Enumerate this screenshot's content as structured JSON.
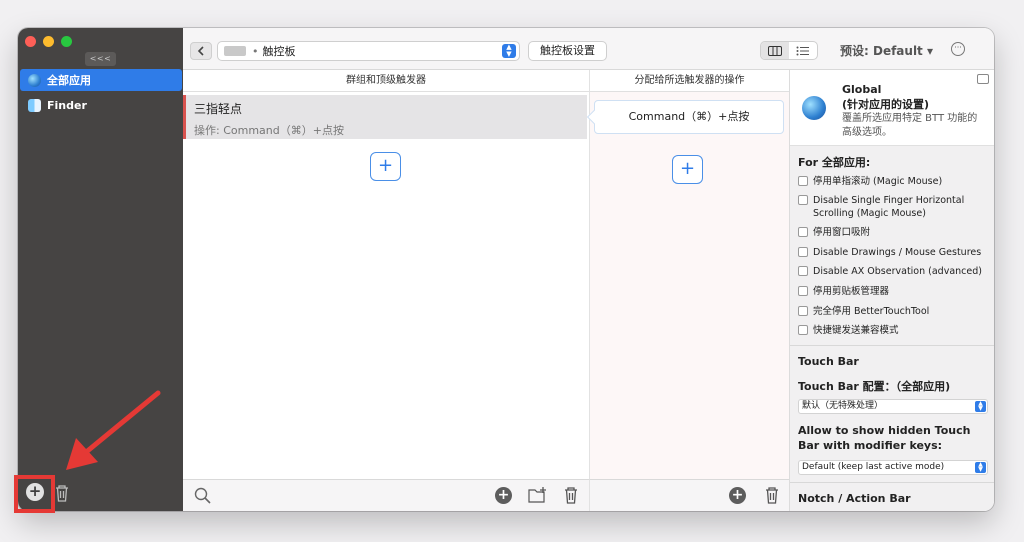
{
  "sidebar": {
    "collapse_label": "<<<",
    "apps": [
      {
        "label": "全部应用",
        "icon": "globe-icon",
        "selected": true
      },
      {
        "label": "Finder",
        "icon": "finder-icon",
        "selected": false
      }
    ]
  },
  "toolbar": {
    "device": "触控板",
    "settings_label": "触控板设置",
    "preset": "预设: Default ▾"
  },
  "triggers": {
    "header": "群组和顶级触发器",
    "items": [
      {
        "title": "三指轻点",
        "subtitle": "操作: Command（⌘）+点按"
      }
    ]
  },
  "actions": {
    "header": "分配给所选触发器的操作",
    "items": [
      {
        "label": "Command（⌘）+点按"
      }
    ]
  },
  "right_panel": {
    "title_line1": "Global",
    "title_line2": "(针对应用的设置)",
    "description": "覆盖所选应用特定 BTT 功能的高级选项。",
    "for_all_apps": "For 全部应用:",
    "options": [
      "停用单指滚动 (Magic Mouse)",
      "Disable Single Finger Horizontal Scrolling (Magic Mouse)",
      "停用窗口吸附",
      "Disable Drawings / Mouse Gestures",
      "Disable AX Observation (advanced)",
      "停用剪贴板管理器",
      "完全停用 BetterTouchTool",
      "快捷键发送兼容模式"
    ],
    "touchbar_title": "Touch Bar",
    "touchbar_config": "Touch Bar 配置：（全部应用)",
    "touchbar_select": "默认（无特殊处理）",
    "hidden_touchbar_label": "Allow to show hidden Touch Bar with modifier keys:",
    "hidden_touchbar_select": "Default (keep last active mode)",
    "notch_title": "Notch / Action Bar"
  },
  "colors": {
    "accent": "#2f7ce8",
    "sidebar_bg": "#464443",
    "annotation": "#e53935"
  }
}
